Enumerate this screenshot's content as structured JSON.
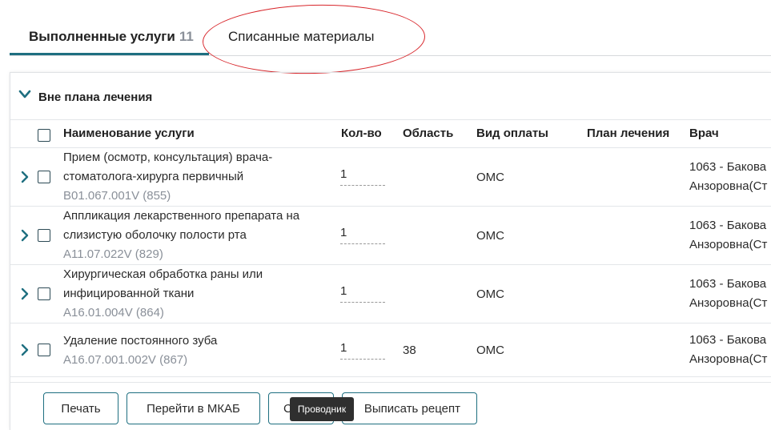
{
  "tabs": {
    "done_label": "Выполненные услуги",
    "done_count": "11",
    "written_off_label": "Списанные материалы"
  },
  "group": {
    "title": "Вне плана лечения"
  },
  "columns": {
    "name": "Наименование услуги",
    "qty": "Кол-во",
    "area": "Область",
    "payment": "Вид оплаты",
    "plan": "План лечения",
    "doctor": "Врач"
  },
  "rows": [
    {
      "name_line1": "Прием (осмотр, консультация) врача-",
      "name_line2": "стоматолога-хирурга первичный",
      "code": "B01.067.001V (855)",
      "qty": "1",
      "area": "",
      "payment": "ОМС",
      "plan": "",
      "doctor_line1": "1063 - Бакова",
      "doctor_line2": "Анзоровна(Ст"
    },
    {
      "name_line1": "Аппликация лекарственного препарата на",
      "name_line2": "слизистую оболочку полости рта",
      "code": "A11.07.022V (829)",
      "qty": "1",
      "area": "",
      "payment": "ОМС",
      "plan": "",
      "doctor_line1": "1063 - Бакова",
      "doctor_line2": "Анзоровна(Ст"
    },
    {
      "name_line1": "Хирургическая обработка раны или",
      "name_line2": "инфицированной ткани",
      "code": "A16.01.004V (864)",
      "qty": "1",
      "area": "",
      "payment": "ОМС",
      "plan": "",
      "doctor_line1": "1063 - Бакова",
      "doctor_line2": "Анзоровна(Ст"
    },
    {
      "name_line1": "Удаление постоянного зуба",
      "name_line2": "",
      "code": "A16.07.001.002V (867)",
      "qty": "1",
      "area": "38",
      "payment": "ОМС",
      "plan": "",
      "doctor_line1": "1063 - Бакова",
      "doctor_line2": "Анзоровна(Ст"
    }
  ],
  "buttons": {
    "print": "Печать",
    "go_mkab": "Перейти в МКАБ",
    "partial": "С",
    "prescription": "Выписать рецепт"
  },
  "tooltip": "Проводник"
}
